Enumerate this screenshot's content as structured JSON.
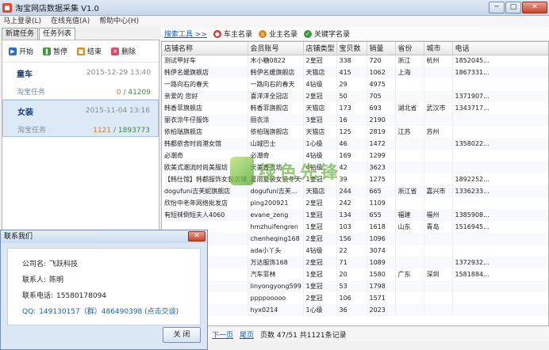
{
  "window": {
    "title": "淘宝网店数据采集 V1.0",
    "buttons": [
      "─",
      "□",
      "✕"
    ]
  },
  "menu": [
    "马上登录(L)",
    "在线充值(A)",
    "帮助中心(H)"
  ],
  "tabs": [
    "新建任务",
    "任务列表"
  ],
  "left_toolbar": [
    {
      "label": "开始",
      "icon": "play-icon",
      "color": "#2d6cc4"
    },
    {
      "label": "暂停",
      "icon": "pause-icon",
      "color": "#3a9a3a"
    },
    {
      "label": "结束",
      "icon": "stop-icon",
      "color": "#e08a1a"
    },
    {
      "label": "删除",
      "icon": "delete-icon",
      "color": "#d84d6b"
    }
  ],
  "tasks": [
    {
      "name": "童车",
      "date": "2015-12-29 13:40",
      "type": "淘宝任务",
      "done": "0",
      "total": "41209"
    },
    {
      "name": "女装",
      "date": "2015-11-04 13:16",
      "type": "淘宝任务",
      "done": "1121",
      "total": "1893773"
    }
  ],
  "toolbar": {
    "label": "搜索工具 >>",
    "items": [
      "车主名录",
      "业主名录",
      "关键字名录"
    ]
  },
  "table": {
    "headers": [
      "店铺名称",
      "会员账号",
      "店铺类型",
      "宝贝数",
      "销量",
      "省份",
      "城市",
      "电话"
    ],
    "rows": [
      [
        "测试甲好车",
        "木小糖0822",
        "2皇冠",
        "338",
        "720",
        "浙江",
        "杭州",
        "1852045..."
      ],
      [
        "韩伊名媛旗舰店",
        "韩伊名媛旗舰店",
        "天猫店",
        "415",
        "1062",
        "上海",
        "",
        "1867331..."
      ],
      [
        "一路向右的春天",
        "一路向右的春天",
        "4钻级",
        "29",
        "4975",
        "",
        "",
        ""
      ],
      [
        "亲爱的 您好",
        "喜洋洋全冠店",
        "2皇冠",
        "50",
        "705",
        "",
        "",
        "1371907..."
      ],
      [
        "韩香菲旗舰店",
        "韩香菲旗舰店",
        "天猫店",
        "173",
        "693",
        "湖北省",
        "武汉市",
        "1343717..."
      ],
      [
        "丽衣涂牛仔服饰",
        "丽衣涂",
        "3皇冠",
        "16",
        "2190",
        "",
        "",
        ""
      ],
      [
        "依柏瑞旗舰店",
        "依柏瑞旗舰店",
        "天猫店",
        "125",
        "2819",
        "江苏",
        "苏州",
        ""
      ],
      [
        "韩都依舍时尚港女馆",
        "山城巴士",
        "1心级",
        "46",
        "1472",
        "",
        "",
        "1358022..."
      ],
      [
        "必潮奇",
        "必潮奇",
        "4钻级",
        "169",
        "1299",
        "",
        "",
        ""
      ],
      [
        "欧美式潮流时尚美服坊",
        "天美香衣坊",
        "4钻级",
        "42",
        "3623",
        "",
        "",
        ""
      ],
      [
        "【韩仕馆】韩都服饰女装店铺",
        "夏雨夏装女装冬天",
        "1皇冠",
        "39",
        "1275",
        "",
        "",
        "1892252..."
      ],
      [
        "dogufuni吉芙妮旗舰店",
        "dogufuni吉芙...",
        "天猫店",
        "244",
        "665",
        "浙江省",
        "嘉兴市",
        "1336233..."
      ],
      [
        "欣怡中老年网络批发店",
        "ping200921",
        "2皇冠",
        "242",
        "1109",
        "",
        "",
        ""
      ],
      [
        "有短袜倒短夫人4060",
        "evane_zeng",
        "1皇冠",
        "134",
        "655",
        "福建",
        "福州",
        "1385908..."
      ],
      [
        "",
        "hmzhuifengren",
        "1皇冠",
        "103",
        "1618",
        "山东",
        "青岛",
        "1516945..."
      ],
      [
        "",
        "chenheqing168",
        "2皇冠",
        "156",
        "1096",
        "",
        "",
        ""
      ],
      [
        "",
        "ada小丫头",
        "4钻级",
        "22",
        "3074",
        "",
        "",
        ""
      ],
      [
        "",
        "万达服饰168",
        "2皇冠",
        "71",
        "1089",
        "",
        "",
        "1372932..."
      ],
      [
        "店",
        "汽车菲林",
        "1皇冠",
        "20",
        "1580",
        "广东",
        "深圳",
        "1581884..."
      ],
      [
        "装店",
        "linyongyong599",
        "1皇冠",
        "53",
        "1798",
        "",
        "",
        ""
      ],
      [
        "",
        "ppppooooo",
        "2皇冠",
        "106",
        "1571",
        "",
        "",
        ""
      ],
      [
        "",
        "hyx0214",
        "1心级",
        "36",
        "2023",
        "",
        "",
        ""
      ]
    ]
  },
  "pager": {
    "next": "下一页",
    "last": "尾页",
    "info": "页数 47/51 共1121条记录"
  },
  "watermark": {
    "text": "绿色先锋"
  },
  "dialog": {
    "title": "联系我们",
    "close": "✕",
    "company_label": "公司名:",
    "company": "飞跃科技",
    "contact_label": "联系人:",
    "contact": "陈明",
    "phone_label": "联系电话:",
    "phone": "15580178094",
    "qq_label": "QQ:",
    "qq": "149130157（群）486490398 (点击交谈)",
    "ok": "关 闭"
  }
}
